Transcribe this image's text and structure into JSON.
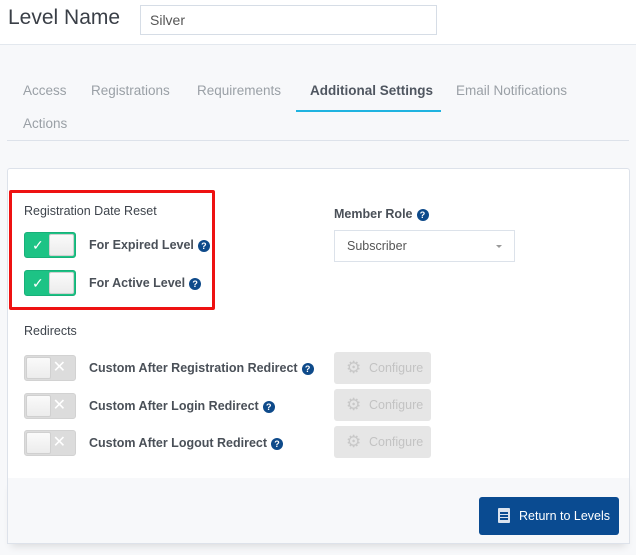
{
  "header": {
    "level_label": "Level Name",
    "level_value": "Silver"
  },
  "tabs": [
    {
      "label": "Access",
      "active": false
    },
    {
      "label": "Registrations",
      "active": false
    },
    {
      "label": "Requirements",
      "active": false
    },
    {
      "label": "Additional Settings",
      "active": true
    },
    {
      "label": "Email Notifications",
      "active": false
    },
    {
      "label": "Actions",
      "active": false
    }
  ],
  "registration_date_reset": {
    "title": "Registration Date Reset",
    "options": [
      {
        "label": "For Expired Level",
        "enabled": true,
        "icon": "check-icon"
      },
      {
        "label": "For Active Level",
        "enabled": true,
        "icon": "check-icon"
      }
    ]
  },
  "member_role": {
    "label": "Member Role",
    "selected": "Subscriber"
  },
  "redirects": {
    "title": "Redirects",
    "items": [
      {
        "label": "Custom After Registration Redirect",
        "enabled": false,
        "button": "Configure"
      },
      {
        "label": "Custom After Login Redirect",
        "enabled": false,
        "button": "Configure"
      },
      {
        "label": "Custom After Logout Redirect",
        "enabled": false,
        "button": "Configure"
      }
    ]
  },
  "icons": {
    "check": "✓",
    "cross": "✕",
    "help": "?",
    "gear": "⚙"
  },
  "footer": {
    "return_label": "Return to Levels"
  },
  "colors": {
    "toggle_on": "#1dc385",
    "primary": "#0a4b91",
    "tab_active_underline": "#1fb3e0",
    "highlight": "#ee1111"
  }
}
